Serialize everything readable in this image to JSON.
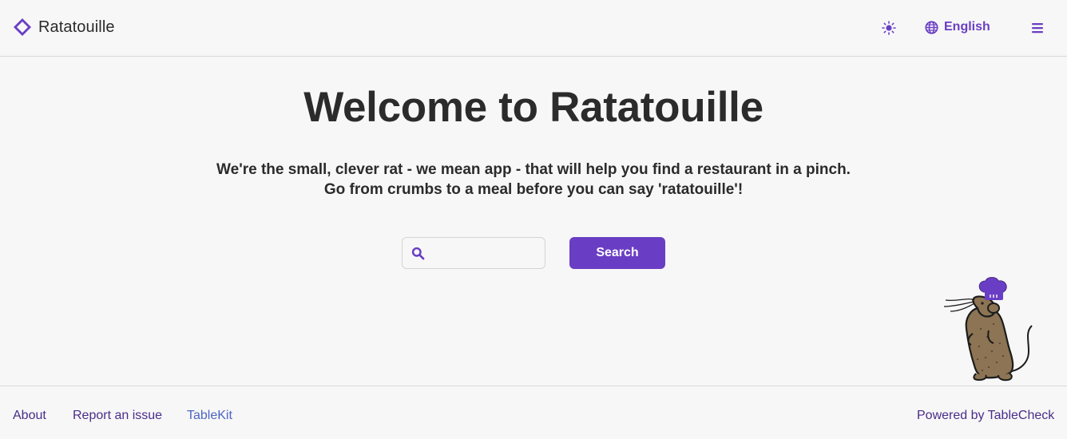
{
  "header": {
    "app_name": "Ratatouille",
    "language_label": "English",
    "icons": {
      "logo": "ratatouille-logo",
      "theme": "sun-icon",
      "language": "globe-icon",
      "menu": "hamburger-menu-icon"
    }
  },
  "main": {
    "title": "Welcome to Ratatouille",
    "tagline_line1": "We're the small, clever rat - we mean app - that will help you find a restaurant in a pinch.",
    "tagline_line2": "Go from crumbs to a meal before you can say 'ratatouille'!",
    "search": {
      "value": "",
      "placeholder": "",
      "button_label": "Search",
      "icon": "search-icon"
    }
  },
  "footer": {
    "links": {
      "about": "About",
      "report": "Report an issue",
      "tablekit": "TableKit"
    },
    "powered_by": "Powered by TableCheck"
  },
  "colors": {
    "accent": "#6a3ec4",
    "background": "#f7f7f7",
    "text": "#2b2b2b",
    "link": "#4a2d8a",
    "tablekit_link": "#4d64c4",
    "border": "#d9d9d9",
    "mascot_body": "#8c7454"
  }
}
